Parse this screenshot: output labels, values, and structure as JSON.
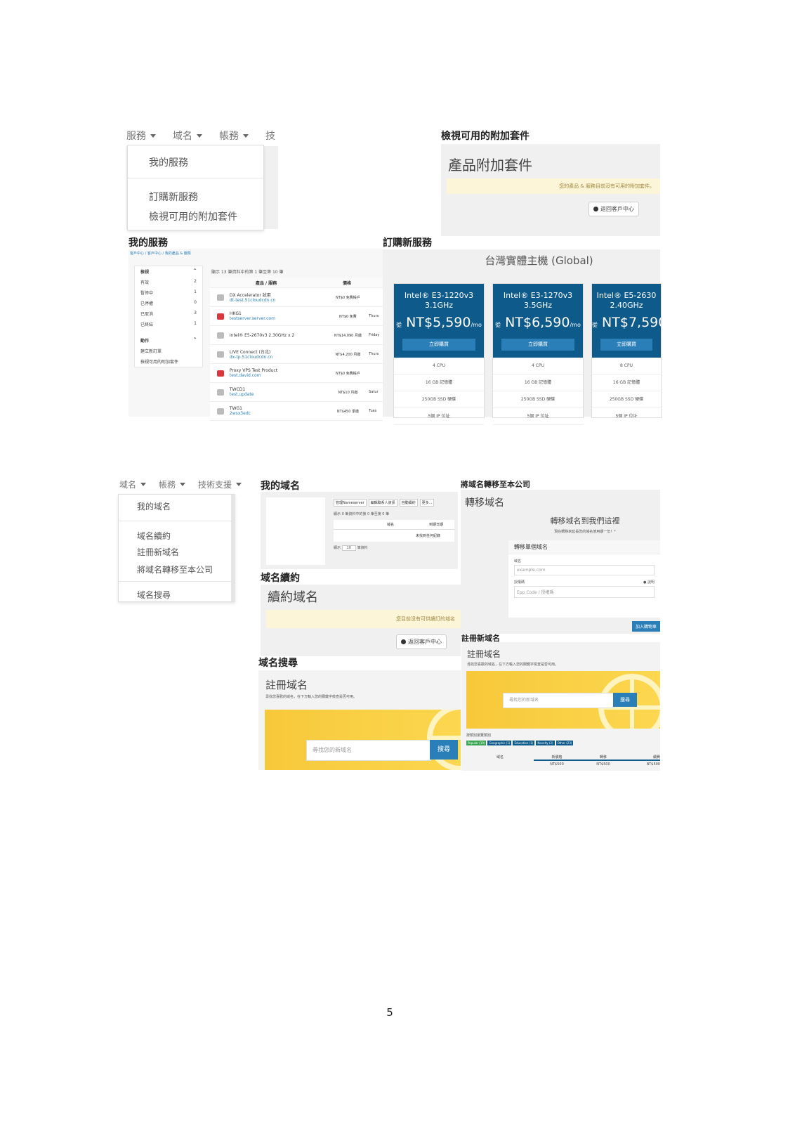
{
  "top_left": {
    "nav": [
      "服務",
      "域名",
      "帳務",
      "技"
    ],
    "menu": [
      "我的服務",
      "訂購新服務",
      "檢視可用的附加套件"
    ]
  },
  "addons": {
    "label": "檢視可用的附加套件",
    "title": "產品附加套件",
    "alert": "您的產品 & 服務目前沒有可用的附加套件。",
    "back": "返回客戶中心"
  },
  "my_services": {
    "label": "我的服務",
    "breadcrumb": "客戶中心 / 客戶中心 / 我的產品 & 服務",
    "filter_title": "檢視",
    "filters": [
      {
        "name": "有效",
        "count": "2"
      },
      {
        "name": "暫停中",
        "count": "1"
      },
      {
        "name": "已停權",
        "count": "0"
      },
      {
        "name": "已取消",
        "count": "3"
      },
      {
        "name": "已終結",
        "count": "1"
      }
    ],
    "actions_title": "動作",
    "actions": [
      "建立新訂單",
      "檢視可用的附加套件"
    ],
    "count_text": "顯示 13 筆資料中的第 1 筆至第 10 筆",
    "col_product": "產品 / 服務",
    "col_price": "價格",
    "rows": [
      {
        "name": "DX Accelerator 試用",
        "domain": "dt-test.51cloudcdn.cn",
        "price": "NT$0 免費帳戶",
        "date": ""
      },
      {
        "name": "HKG1",
        "domain": "testserver.server.com",
        "price": "NT$0 免費",
        "date": "Thurs"
      },
      {
        "name": "Intel® E5-2670v3 2.30GHz x 2",
        "domain": "",
        "price": "NT$14,090 月繳",
        "date": "Friday"
      },
      {
        "name": "LIVE Connect (台北)",
        "domain": "dx-tp.51cloudcdn.cn",
        "price": "NT$4,200 月繳",
        "date": "Thurs"
      },
      {
        "name": "Proxy VPS Test Product",
        "domain": "test.david.com",
        "price": "NT$0 免費帳戶",
        "date": ""
      },
      {
        "name": "TWCD1",
        "domain": "test.update",
        "price": "NT$10 月繳",
        "date": "Satur"
      },
      {
        "name": "TWG1",
        "domain": "2wsx3edc",
        "price": "NT$450 季繳",
        "date": "Tues"
      }
    ]
  },
  "order": {
    "label": "訂購新服務",
    "title": "台灣實體主機 (Global)",
    "cards": [
      {
        "name1": "Intel® E3-1220v3",
        "name2": "3.1GHz",
        "from": "從",
        "price": "NT$5,590",
        "unit": "/mo",
        "buy": "立即購買",
        "feats": [
          "4 CPU",
          "16 GB 記憶體",
          "250GB SSD 硬碟",
          "5個 IP 位址"
        ]
      },
      {
        "name1": "Intel® E3-1270v3",
        "name2": "3.5GHz",
        "from": "從",
        "price": "NT$6,590",
        "unit": "/mo",
        "buy": "立即購買",
        "feats": [
          "4 CPU",
          "16 GB 記憶體",
          "250GB SSD 硬碟",
          "5個 IP 位址"
        ]
      },
      {
        "name1": "Intel® E5-2630",
        "name2": "2.40GHz",
        "from": "從",
        "price": "NT$7,590",
        "unit": "",
        "buy": "立即購買",
        "feats": [
          "8 CPU",
          "16 GB 記憶體",
          "250GB SSD 硬碟",
          "5個 IP 位址"
        ]
      }
    ]
  },
  "bottom_left": {
    "nav": [
      "域名",
      "帳務",
      "技術支援"
    ],
    "menu": [
      "我的域名",
      "域名續約",
      "註冊新域名",
      "將域名轉移至本公司",
      "域名搜尋"
    ]
  },
  "my_domains": {
    "label": "我的域名",
    "toolbar": [
      "管理Nameserver",
      "編輯聯系人資訊",
      "自動續約",
      "更多..."
    ],
    "count_text": "顯示 0 筆資料中的第 0 筆至第 0 筆",
    "cols": [
      "域名",
      "到期日期"
    ],
    "empty": "未找到任何紀錄",
    "show": "顯示",
    "per": "筆資料"
  },
  "transfer": {
    "label": "將域名轉移至本公司",
    "title": "轉移域名",
    "heading": "轉移域名到我們這裡",
    "sub": "現在轉移來延長您的域名使用期一年！*",
    "box_title": "轉移單個域名",
    "domain_label": "域名",
    "domain_ph": "example.com",
    "auth_label": "授權碼",
    "help": "說明",
    "auth_ph": "Epp Code / 授權碼",
    "cart_btn": "加入購物車"
  },
  "renew": {
    "label": "域名續約",
    "title": "續約域名",
    "alert": "您目前沒有可供續訂的域名",
    "back": "返回客戶中心"
  },
  "register": {
    "label": "註冊新域名",
    "title": "註冊域名",
    "desc": "尋找您喜歡的域名，在下方輸入您的關鍵字檢查是否可用。",
    "placeholder": "尋找您的新域名",
    "btn": "搜尋",
    "browse": "按類別瀏覽類別",
    "tags": [
      "Popular (19)",
      "Geographic (1)",
      "Education (1)",
      "Novelty (2)",
      "Other (23)"
    ],
    "cols": [
      "域名",
      "新價格",
      "轉移",
      "續費"
    ],
    "prices": [
      "NT$500",
      "NT$500",
      "NT$500"
    ]
  },
  "search": {
    "label": "域名搜尋",
    "title": "註冊域名",
    "desc": "尋找您喜歡的域名，在下方輸入您的關鍵字檢查是否可用。",
    "placeholder": "尋找您的新域名",
    "btn": "搜尋"
  },
  "page_number": "5"
}
